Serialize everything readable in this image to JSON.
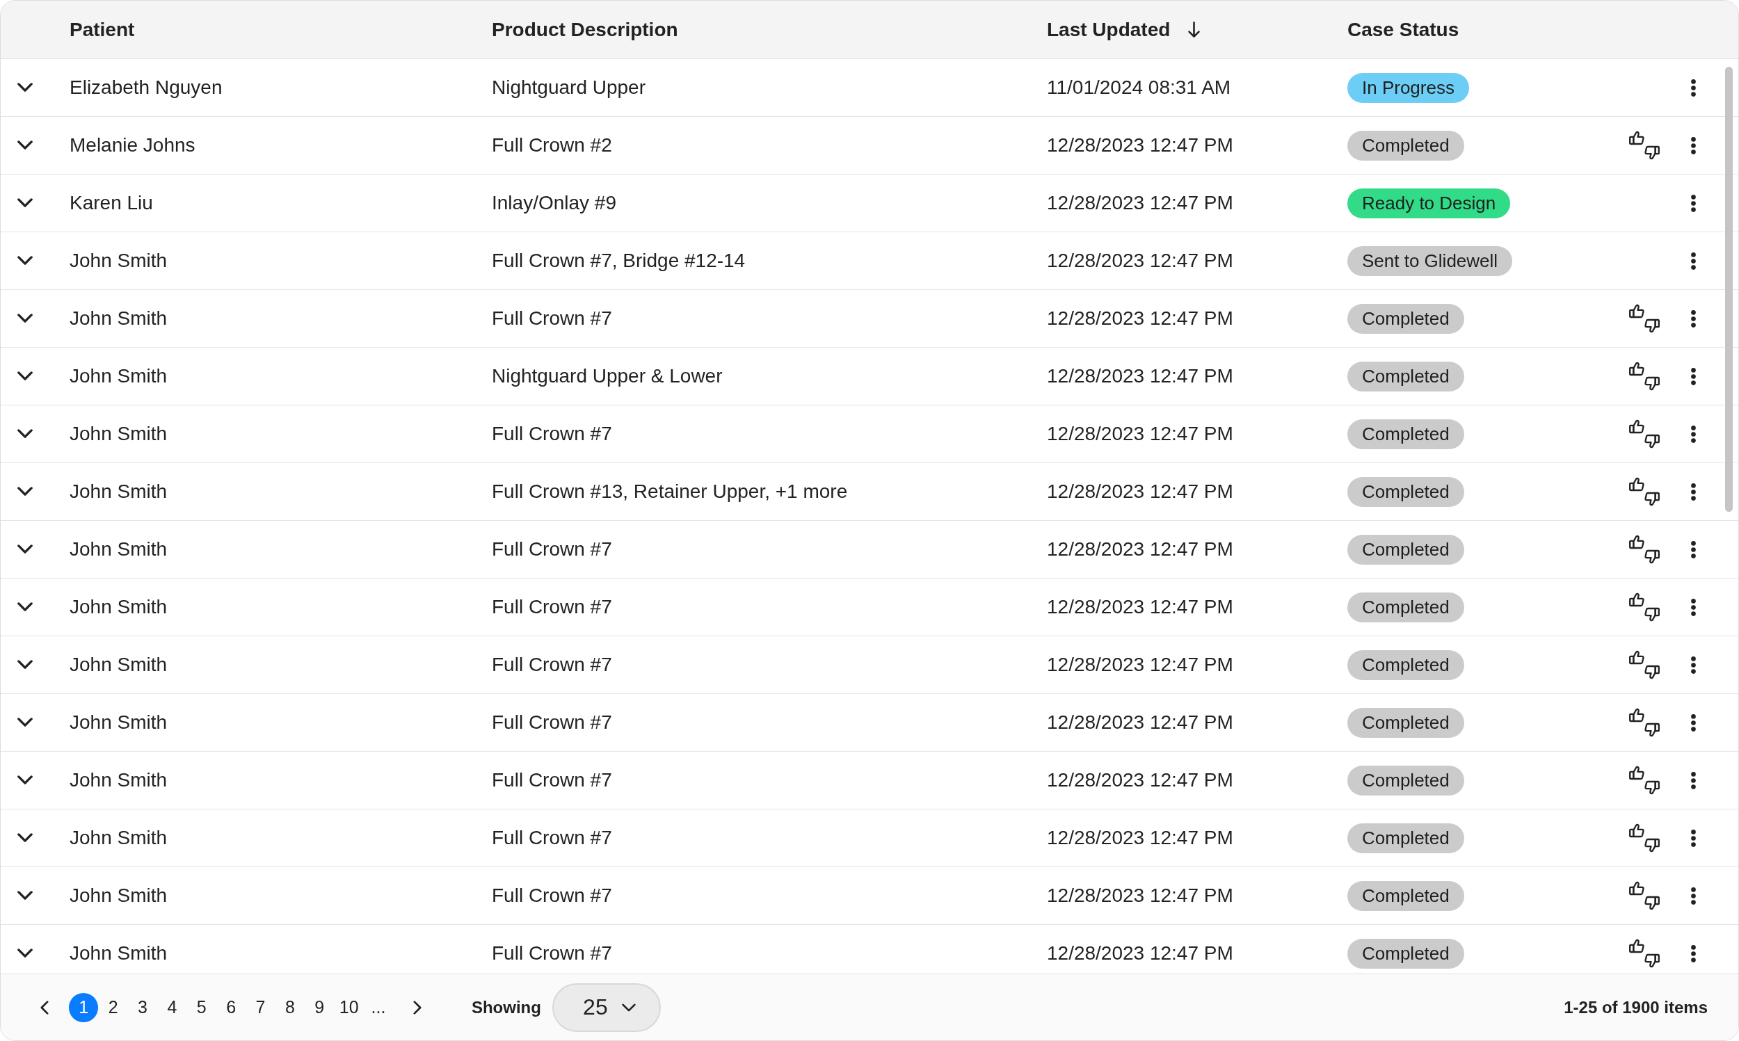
{
  "table": {
    "columns": [
      {
        "label": "Patient",
        "sorted": false
      },
      {
        "label": "Product Description",
        "sorted": false
      },
      {
        "label": "Last Updated",
        "sorted": true
      },
      {
        "label": "Case Status",
        "sorted": false
      }
    ],
    "rows": [
      {
        "expanded": false,
        "patient": "Elizabeth Nguyen",
        "product": "Nightguard Upper",
        "last_updated": "11/01/2024 08:31 AM",
        "status": {
          "label": "In Progress",
          "color": "#6ccdf5"
        },
        "feedback": false
      },
      {
        "expanded": false,
        "patient": "Melanie Johns",
        "product": "Full Crown #2",
        "last_updated": "12/28/2023 12:47 PM",
        "status": {
          "label": "Completed",
          "color": "#cbcbcb"
        },
        "feedback": true
      },
      {
        "expanded": false,
        "patient": "Karen Liu",
        "product": "Inlay/Onlay #9",
        "last_updated": "12/28/2023 12:47 PM",
        "status": {
          "label": "Ready to Design",
          "color": "#31db88"
        },
        "feedback": false
      },
      {
        "expanded": false,
        "patient": "John Smith",
        "product": "Full Crown #7, Bridge #12-14",
        "last_updated": "12/28/2023 12:47 PM",
        "status": {
          "label": "Sent to Glidewell",
          "color": "#cbcbcb"
        },
        "feedback": false
      },
      {
        "expanded": false,
        "patient": "John Smith",
        "product": "Full Crown #7",
        "last_updated": "12/28/2023 12:47 PM",
        "status": {
          "label": "Completed",
          "color": "#cbcbcb"
        },
        "feedback": true
      },
      {
        "expanded": false,
        "patient": "John Smith",
        "product": "Nightguard Upper & Lower",
        "last_updated": "12/28/2023 12:47 PM",
        "status": {
          "label": "Completed",
          "color": "#cbcbcb"
        },
        "feedback": true
      },
      {
        "expanded": false,
        "patient": "John Smith",
        "product": "Full Crown #7",
        "last_updated": "12/28/2023 12:47 PM",
        "status": {
          "label": "Completed",
          "color": "#cbcbcb"
        },
        "feedback": true
      },
      {
        "expanded": false,
        "patient": "John Smith",
        "product": "Full Crown #13, Retainer Upper, +1 more",
        "last_updated": "12/28/2023 12:47 PM",
        "status": {
          "label": "Completed",
          "color": "#cbcbcb"
        },
        "feedback": true
      },
      {
        "expanded": false,
        "patient": "John Smith",
        "product": "Full Crown #7",
        "last_updated": "12/28/2023 12:47 PM",
        "status": {
          "label": "Completed",
          "color": "#cbcbcb"
        },
        "feedback": true
      },
      {
        "expanded": false,
        "patient": "John Smith",
        "product": "Full Crown #7",
        "last_updated": "12/28/2023 12:47 PM",
        "status": {
          "label": "Completed",
          "color": "#cbcbcb"
        },
        "feedback": true
      },
      {
        "expanded": false,
        "patient": "John Smith",
        "product": "Full Crown #7",
        "last_updated": "12/28/2023 12:47 PM",
        "status": {
          "label": "Completed",
          "color": "#cbcbcb"
        },
        "feedback": true
      },
      {
        "expanded": false,
        "patient": "John Smith",
        "product": "Full Crown #7",
        "last_updated": "12/28/2023 12:47 PM",
        "status": {
          "label": "Completed",
          "color": "#cbcbcb"
        },
        "feedback": true
      },
      {
        "expanded": false,
        "patient": "John Smith",
        "product": "Full Crown #7",
        "last_updated": "12/28/2023 12:47 PM",
        "status": {
          "label": "Completed",
          "color": "#cbcbcb"
        },
        "feedback": true
      },
      {
        "expanded": false,
        "patient": "John Smith",
        "product": "Full Crown #7",
        "last_updated": "12/28/2023 12:47 PM",
        "status": {
          "label": "Completed",
          "color": "#cbcbcb"
        },
        "feedback": true
      },
      {
        "expanded": false,
        "patient": "John Smith",
        "product": "Full Crown #7",
        "last_updated": "12/28/2023 12:47 PM",
        "status": {
          "label": "Completed",
          "color": "#cbcbcb"
        },
        "feedback": true
      },
      {
        "expanded": false,
        "patient": "John Smith",
        "product": "Full Crown #7",
        "last_updated": "12/28/2023 12:47 PM",
        "status": {
          "label": "Completed",
          "color": "#cbcbcb"
        },
        "feedback": true
      }
    ]
  },
  "pagination": {
    "pages": [
      {
        "label": "1",
        "selected": true
      },
      {
        "label": "2",
        "selected": false
      },
      {
        "label": "3",
        "selected": false
      },
      {
        "label": "4",
        "selected": false
      },
      {
        "label": "5",
        "selected": false
      },
      {
        "label": "6",
        "selected": false
      },
      {
        "label": "7",
        "selected": false
      },
      {
        "label": "8",
        "selected": false
      },
      {
        "label": "9",
        "selected": false
      },
      {
        "label": "10",
        "selected": false
      }
    ],
    "ellipsis": "...",
    "page_size_label": "Showing",
    "page_size": "25",
    "summary": "1-25 of 1900 items"
  }
}
